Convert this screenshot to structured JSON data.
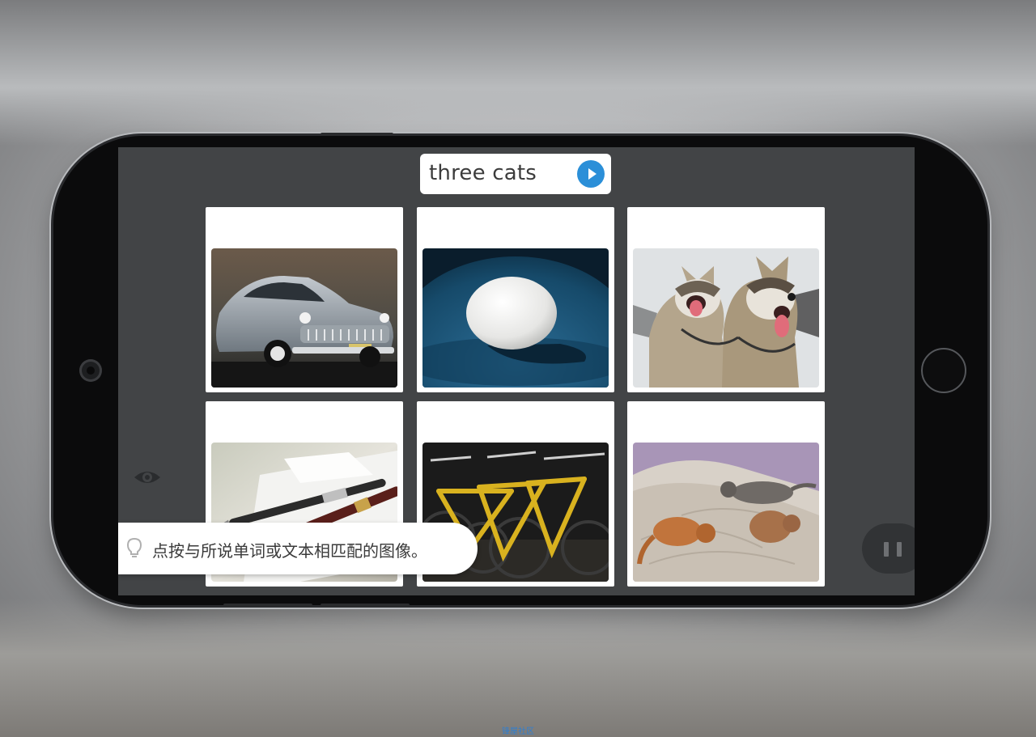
{
  "prompt": {
    "text": "three cats",
    "play_icon": "play-icon",
    "accent_color": "#2b8fd8"
  },
  "grid": {
    "cards": [
      {
        "subject": "vintage car",
        "icon": "car-photo"
      },
      {
        "subject": "white egg in blue bowl",
        "icon": "egg-photo"
      },
      {
        "subject": "two husky dogs",
        "icon": "dogs-photo"
      },
      {
        "subject": "pens on paper",
        "icon": "pens-photo"
      },
      {
        "subject": "yellow bicycles",
        "icon": "bicycles-photo"
      },
      {
        "subject": "three cats on a bed",
        "icon": "cats-photo"
      }
    ]
  },
  "controls": {
    "eye_icon": "eye-icon",
    "pause_icon": "pause-icon"
  },
  "hint": {
    "icon": "lightbulb-icon",
    "text": "点按与所说单词或文本相匹配的图像。"
  },
  "watermark": {
    "text": "锋屋社区"
  }
}
